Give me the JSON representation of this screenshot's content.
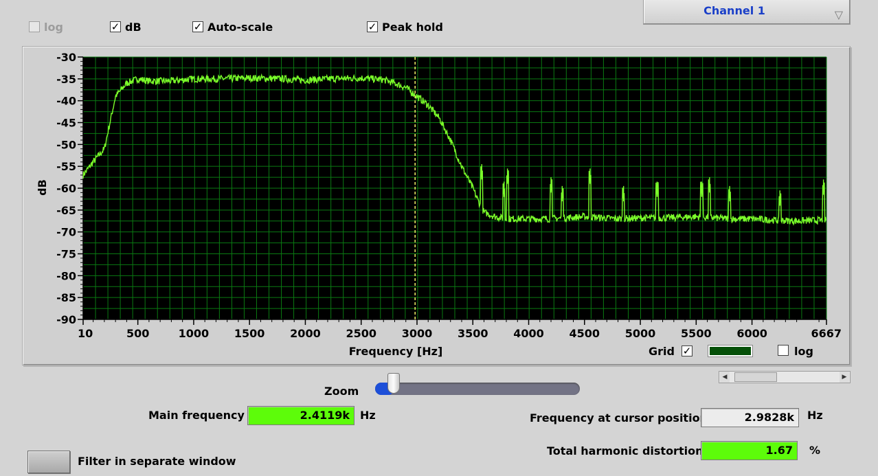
{
  "toolbar": {
    "log_label": "log",
    "log_checked": false,
    "db_label": "dB",
    "db_checked": true,
    "autoscale_label": "Auto-scale",
    "autoscale_checked": true,
    "peakhold_label": "Peak hold",
    "peakhold_checked": true
  },
  "channel_select": {
    "value": "Channel 1"
  },
  "chart_data": {
    "type": "line",
    "title": "",
    "xlabel": "Frequency [Hz]",
    "ylabel": "dB",
    "xlim": [
      10,
      6667
    ],
    "ylim": [
      -90,
      -30
    ],
    "x_ticks": [
      "10",
      "500",
      "1000",
      "1500",
      "2000",
      "2500",
      "3000",
      "3500",
      "4000",
      "4500",
      "5000",
      "5500",
      "6000",
      "6667"
    ],
    "y_ticks": [
      "-30",
      "-35",
      "-40",
      "-45",
      "-50",
      "-55",
      "-60",
      "-65",
      "-70",
      "-75",
      "-80",
      "-85",
      "-90"
    ],
    "grid": true,
    "background": "#000000",
    "grid_color": "#0a7a12",
    "line_color": "#7cff2a",
    "cursor_color": "#f5f06a",
    "cursor_x": 2982.8,
    "series": [
      {
        "x": [
          10,
          100,
          200,
          250,
          300,
          400,
          500,
          600,
          800,
          1000,
          1200,
          1500,
          1800,
          2000,
          2200,
          2500,
          2700,
          2800,
          2900,
          3000,
          3100,
          3200,
          3300,
          3400,
          3500,
          3550,
          3600,
          3700,
          3800,
          4000,
          4200,
          4500,
          4800,
          5000,
          5200,
          5500,
          5800,
          6000,
          6200,
          6400,
          6667
        ],
        "y": [
          -57,
          -54,
          -51,
          -45,
          -39,
          -36,
          -35,
          -35.5,
          -35.5,
          -35,
          -35,
          -34.8,
          -35,
          -35.3,
          -35,
          -34.8,
          -35.2,
          -36,
          -37,
          -39,
          -41,
          -44,
          -49,
          -55,
          -60,
          -63,
          -65.5,
          -66.5,
          -67,
          -67,
          -67,
          -66.5,
          -67,
          -66.8,
          -66.8,
          -66.5,
          -67,
          -67,
          -67.3,
          -67.5,
          -67.3
        ]
      }
    ],
    "peaks": [
      {
        "x": 3580,
        "y": -58
      },
      {
        "x": 3780,
        "y": -62
      },
      {
        "x": 3810,
        "y": -59
      },
      {
        "x": 4200,
        "y": -61
      },
      {
        "x": 4300,
        "y": -63
      },
      {
        "x": 4550,
        "y": -59
      },
      {
        "x": 4850,
        "y": -63
      },
      {
        "x": 5150,
        "y": -62
      },
      {
        "x": 5550,
        "y": -62
      },
      {
        "x": 5620,
        "y": -61
      },
      {
        "x": 5800,
        "y": -63
      },
      {
        "x": 6250,
        "y": -64
      },
      {
        "x": 6640,
        "y": -61.5
      }
    ]
  },
  "plot_controls": {
    "grid_label": "Grid",
    "grid_checked": true,
    "grid_color": "#055008",
    "log_label": "log",
    "log_checked": false
  },
  "zoom": {
    "label": "Zoom",
    "value": 0.06
  },
  "scrollbar": {
    "position": 0.22
  },
  "readouts": {
    "main_frequency_label": "Main frequency",
    "main_frequency_value": "2.4119k",
    "main_frequency_unit": "Hz",
    "cursor_freq_label": "Frequency at cursor position",
    "cursor_freq_value": "2.9828k",
    "cursor_freq_unit": "Hz",
    "thd_label": "Total harmonic distortion",
    "thd_value": "1.67",
    "thd_unit": "%"
  },
  "filter_button": {
    "label": "Filter in separate window"
  },
  "check_glyph": "✓"
}
